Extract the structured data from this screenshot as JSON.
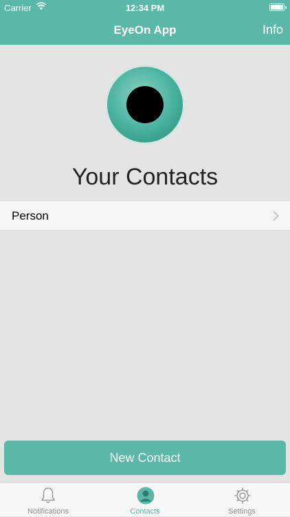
{
  "status": {
    "carrier": "Carrier",
    "time": "12:34 PM"
  },
  "nav": {
    "title": "EyeOn App",
    "info_label": "Info"
  },
  "main": {
    "heading": "Your Contacts",
    "contacts": [
      {
        "name": "Person"
      }
    ],
    "new_contact_label": "New Contact"
  },
  "tabs": [
    {
      "label": "Notifications",
      "icon": "bell-icon",
      "active": false
    },
    {
      "label": "Contacts",
      "icon": "person-icon",
      "active": true
    },
    {
      "label": "Settings",
      "icon": "gear-icon",
      "active": false
    }
  ],
  "colors": {
    "accent": "#5bb8a8",
    "background": "#e4e4e4"
  }
}
